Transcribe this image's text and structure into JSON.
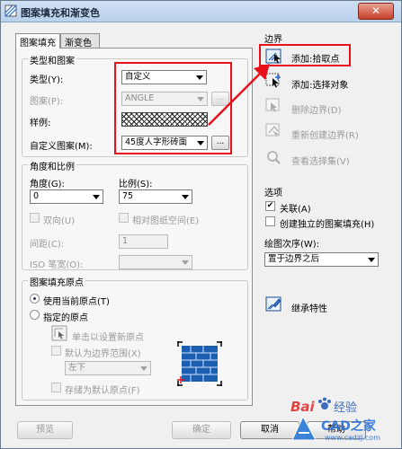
{
  "window": {
    "title": "图案填充和渐变色",
    "close_label": "✕"
  },
  "tabs": [
    "图案填充",
    "渐变色"
  ],
  "type_group": {
    "title": "类型和图案",
    "type_label": "类型(Y):",
    "type_value": "自定义",
    "pattern_label": "图案(P):",
    "pattern_value": "ANGLE",
    "swatch_label": "样例:",
    "custom_label": "自定义图案(M):",
    "custom_value": "45度人字形砖面",
    "dots": "..."
  },
  "angle_group": {
    "title": "角度和比例",
    "angle_label": "角度(G):",
    "angle_value": "0",
    "scale_label": "比例(S):",
    "scale_value": "75",
    "double_label": "双向(U)",
    "relative_label": "相对图纸空间(E)",
    "spacing_label": "间距(C):",
    "spacing_value": "1",
    "iso_label": "ISO 笔宽(O):"
  },
  "origin_group": {
    "title": "图案填充原点",
    "current_origin": "使用当前原点(T)",
    "specified_origin": "指定的原点",
    "click_set": "单击以设置新原点",
    "default_extent": "默认为边界范围(X)",
    "position_value": "左下",
    "store_default": "存储为默认原点(F)"
  },
  "boundary": {
    "title": "边界",
    "items": [
      "添加:拾取点",
      "添加:选择对象",
      "删除边界(D)",
      "重新创建边界(R)",
      "查看选择集(V)"
    ]
  },
  "options": {
    "title": "选项",
    "associative": "关联(A)",
    "independent": "创建独立的图案填充(H)",
    "draw_order_label": "绘图次序(W):",
    "draw_order_value": "置于边界之后"
  },
  "inherit_label": "继承特性",
  "footer": {
    "preview": "预览",
    "ok": "确定",
    "cancel": "取消",
    "help": "帮助"
  },
  "watermark": {
    "baidu": "Bai",
    "du": "经验",
    "cad": "CAD之家",
    "url": "www.cadzj.com"
  },
  "colors": {
    "annotation_red": "#e8101a",
    "accent_blue": "#2a6fd8"
  }
}
